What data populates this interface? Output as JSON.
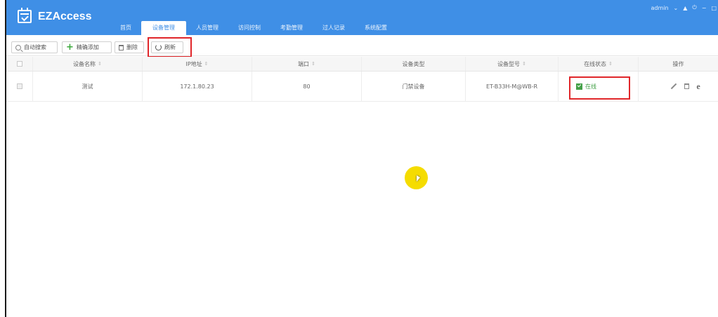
{
  "app": {
    "logo_text": "EZAccess"
  },
  "nav": {
    "tabs": [
      {
        "label": "首页"
      },
      {
        "label": "设备管理",
        "active": true
      },
      {
        "label": "人员管理"
      },
      {
        "label": "访问控制"
      },
      {
        "label": "考勤管理"
      },
      {
        "label": "过人记录"
      },
      {
        "label": "系统配置"
      }
    ]
  },
  "user": {
    "name": "admin",
    "caret": "⌄",
    "lock": "▲",
    "power": "⏻",
    "minimize": "−",
    "maximize": "□"
  },
  "toolbar": {
    "auto_search": "自动搜索",
    "precise_add": "精确添加",
    "delete": "删除",
    "refresh": "刷新"
  },
  "table": {
    "headers": {
      "name": "设备名称",
      "ip": "IP地址",
      "port": "端口",
      "type": "设备类型",
      "model": "设备型号",
      "status": "在线状态",
      "ops": "操作"
    },
    "sort_glyph": "⇕",
    "rows": [
      {
        "name": "测试",
        "ip": "172.1.80.23",
        "port": "80",
        "type": "门禁设备",
        "model": "ET-B33H-M@WB-R",
        "status": "在线"
      }
    ]
  },
  "colors": {
    "header_bg": "#3f8fe6",
    "online": "#43a047",
    "highlight": "#e0262a"
  },
  "icons": [
    "calendar-check-icon",
    "search-icon",
    "plus-icon",
    "trash-icon",
    "refresh-icon",
    "edit-icon",
    "delete-icon",
    "ie-icon"
  ]
}
